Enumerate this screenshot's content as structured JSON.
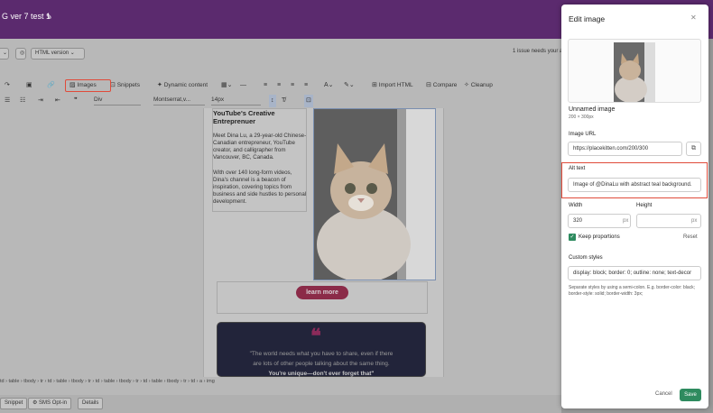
{
  "header": {
    "title": "G ver 7 test 1"
  },
  "topbar": {
    "html_version": "HTML version",
    "issues": "1 issue needs your a"
  },
  "toolbar1": {
    "images": "Images",
    "snippets": "Snippets",
    "dynamic_content": "Dynamic content",
    "import_html": "Import HTML",
    "compare": "Compare",
    "cleanup": "Cleanup"
  },
  "toolbar2": {
    "block": "Div",
    "font": "Montserrat,v...",
    "size": "14px"
  },
  "canvas": {
    "heading": "YouTube's Creative Entreprenuer",
    "para1": "Meet Dina Lu, a 29-year-old Chinese-Canadian entrepreneur, YouTube creator, and calligrapher from Vancouver, BC, Canada.",
    "para2": "With over 140 long-form videos, Dina's channel is a beacon of inspiration, covering topics from business and side hustles to personal development.",
    "learn_more": "learn more",
    "quote_line1": "\"The world needs what you have to share, even if there",
    "quote_line2": "are lots of other people talking about the same thing.",
    "quote_line3": "You're unique—don't ever forget that\""
  },
  "breadcrumb": "td › table › tbody › tr › td › table › tbody › tr › td › table › tbody › tr › td › table › tbody › tr › td › a › img",
  "footer": {
    "tab1": "Snippet",
    "tab2": "SMS Opt-in",
    "tab3": "Details"
  },
  "modal": {
    "title": "Edit image",
    "image_name": "Unnamed image",
    "image_size": "200 × 300px",
    "url_label": "Image URL",
    "url_value": "https://placekitten.com/200/300",
    "alt_label": "Alt text",
    "alt_value": "Image of @DinaLu with abstract teal background.",
    "width_label": "Width",
    "width_value": "320",
    "width_unit": "px",
    "height_label": "Height",
    "height_value": "",
    "height_unit": "px",
    "keep_label": "Keep proportions",
    "reset": "Reset",
    "styles_label": "Custom styles",
    "styles_value": "display: block; border: 0; outline: none; text-decor",
    "styles_help": "Separate styles by using a semi-colon. E.g. border-color: black; border-style: solid; border-width: 3px;",
    "cancel": "Cancel",
    "save": "Save"
  },
  "colors": {
    "header_bg": "#5b2a6e",
    "accent_green": "#2e8b5f",
    "highlight_red": "#e04b3a",
    "button_maroon": "#8b2b48"
  }
}
